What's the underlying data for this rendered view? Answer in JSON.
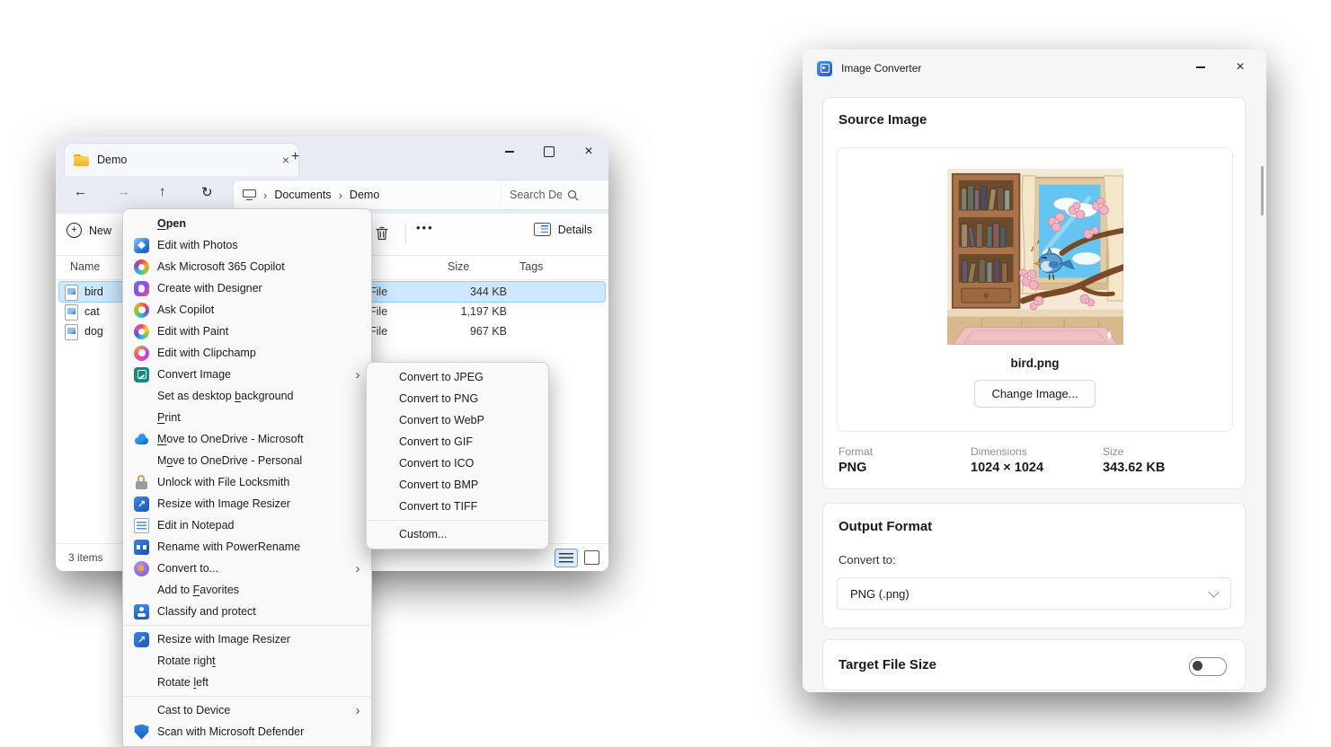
{
  "theme": {
    "desktop_gradient": [
      "#123c2c",
      "#1f8262",
      "#0a3a53"
    ],
    "selection_blue": "#cde8ff",
    "accent_blue": "#2a6bd4",
    "convert_image_icon_teal": "#128a7d"
  },
  "explorer": {
    "tab_title": "Demo",
    "breadcrumb": [
      "Documents",
      "Demo"
    ],
    "search": "Search Demo",
    "toolbar": {
      "new": "New",
      "details": "Details"
    },
    "columns": {
      "name": "Name",
      "size": "Size",
      "tags": "Tags"
    },
    "files": [
      {
        "name": "bird",
        "type": "File",
        "size": "344 KB",
        "selected": true
      },
      {
        "name": "cat",
        "type": "File",
        "size": "1,197 KB",
        "selected": false
      },
      {
        "name": "dog",
        "type": "File",
        "size": "967 KB",
        "selected": false
      }
    ],
    "status": "3 items"
  },
  "context_menu": {
    "items": [
      {
        "label": "Open",
        "icon": "none",
        "u": 0,
        "bold": true
      },
      {
        "label": "Edit with Photos",
        "icon": "photos"
      },
      {
        "label": "Ask Microsoft 365 Copilot",
        "icon": "copilot365"
      },
      {
        "label": "Create with Designer",
        "icon": "designer"
      },
      {
        "label": "Ask Copilot",
        "icon": "copilot"
      },
      {
        "label": "Edit with Paint",
        "icon": "paint"
      },
      {
        "label": "Edit with Clipchamp",
        "icon": "clipchamp"
      },
      {
        "label": "Convert Image",
        "icon": "convertimage",
        "arrow": true
      },
      {
        "label": "Set as desktop background",
        "icon": "none",
        "u": 15
      },
      {
        "label": "Print",
        "icon": "none",
        "u": 0
      },
      {
        "label": "Move to OneDrive - Microsoft",
        "icon": "onedrive",
        "u": 0
      },
      {
        "label": "Move to OneDrive - Personal",
        "icon": "none",
        "u": 1
      },
      {
        "label": "Unlock with File Locksmith",
        "icon": "locksmith"
      },
      {
        "label": "Resize with Image Resizer",
        "icon": "resizer"
      },
      {
        "label": "Edit in Notepad",
        "icon": "notepad"
      },
      {
        "label": "Rename with PowerRename",
        "icon": "powerrename"
      },
      {
        "label": "Convert to...",
        "icon": "convertto",
        "arrow": true
      },
      {
        "label": "Add to Favorites",
        "icon": "none",
        "u": 7
      },
      {
        "label": "Classify and protect",
        "icon": "classify",
        "sep_after": true
      },
      {
        "label": "Resize with Image Resizer",
        "icon": "resizer"
      },
      {
        "label": "Rotate right",
        "icon": "none",
        "u": 11
      },
      {
        "label": "Rotate left",
        "icon": "none",
        "u": 7,
        "sep_after": true
      },
      {
        "label": "Cast to Device",
        "icon": "none",
        "arrow": true
      },
      {
        "label": "Scan with Microsoft Defender",
        "icon": "defender"
      }
    ]
  },
  "convert_submenu": {
    "items": [
      {
        "label": "Convert to JPEG"
      },
      {
        "label": "Convert to PNG"
      },
      {
        "label": "Convert to WebP"
      },
      {
        "label": "Convert to GIF"
      },
      {
        "label": "Convert to ICO"
      },
      {
        "label": "Convert to BMP"
      },
      {
        "label": "Convert to TIFF",
        "sep_after": true
      },
      {
        "label": "Custom..."
      }
    ]
  },
  "converter": {
    "title": "Image Converter",
    "source": {
      "heading": "Source Image",
      "filename": "bird.png",
      "change_button": "Change Image..."
    },
    "info": {
      "format_label": "Format",
      "format": "PNG",
      "dimensions_label": "Dimensions",
      "dimensions": "1024 × 1024",
      "size_label": "Size",
      "size": "343.62 KB"
    },
    "output": {
      "heading": "Output Format",
      "convert_label": "Convert to:",
      "selected": "PNG (.png)"
    },
    "target": {
      "heading": "Target File Size",
      "toggle_on": false
    }
  }
}
